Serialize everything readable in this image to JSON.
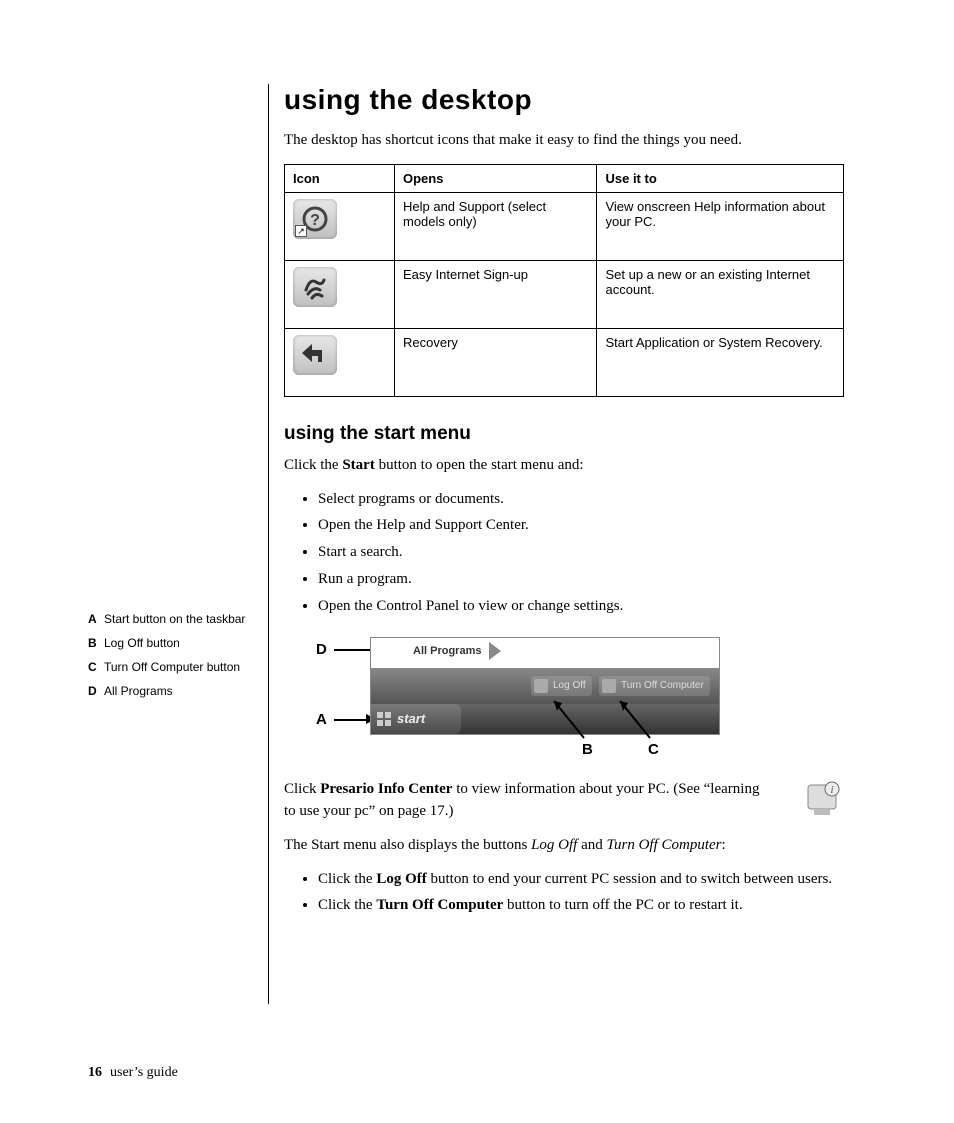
{
  "heading1": "using the desktop",
  "intro": "The desktop has shortcut icons that make it easy to find the things you need.",
  "table": {
    "head": {
      "c1": "Icon",
      "c2": "Opens",
      "c3": "Use it to"
    },
    "rows": [
      {
        "iconName": "help-support-icon",
        "opens": "Help and Support (select models only)",
        "use": "View onscreen Help information about your PC."
      },
      {
        "iconName": "easy-internet-icon",
        "opens": "Easy Internet Sign-up",
        "use": "Set up a new or an existing Internet account."
      },
      {
        "iconName": "recovery-icon",
        "opens": "Recovery",
        "use": "Start Application or System Recovery."
      }
    ]
  },
  "heading2": "using the start menu",
  "startIntro": {
    "pre": "Click the ",
    "bold": "Start",
    "post": " button to open the start menu and:"
  },
  "startBullets": [
    "Select programs or documents.",
    "Open the Help and Support Center.",
    "Start a search.",
    "Run a program.",
    "Open the Control Panel to view or change settings."
  ],
  "legend": [
    {
      "label": "A",
      "text": "Start button on the taskbar"
    },
    {
      "label": "B",
      "text": "Log Off button"
    },
    {
      "label": "C",
      "text": "Turn Off Computer button"
    },
    {
      "label": "D",
      "text": "All Programs"
    }
  ],
  "figure": {
    "callouts": {
      "A": "A",
      "B": "B",
      "C": "C",
      "D": "D"
    },
    "allPrograms": "All Programs",
    "logOff": "Log Off",
    "turnOff": "Turn Off Computer",
    "start": "start"
  },
  "infoPara": {
    "pre": "Click ",
    "bold": "Presario Info Center",
    "post": " to view information about your PC. (See “learning to use your pc” on page 17.)"
  },
  "startMenuAlso": {
    "pre": "The Start menu also displays the buttons ",
    "i1": "Log Off",
    "mid": " and ",
    "i2": "Turn Off Computer",
    "post": ":"
  },
  "endBullets": [
    {
      "pre": "Click the ",
      "bold": "Log Off",
      "post": " button to end your current PC session and to switch between users."
    },
    {
      "pre": "Click the ",
      "bold": "Turn Off Computer",
      "post": " button to turn off the PC or to restart it."
    }
  ],
  "footer": {
    "page": "16",
    "title": "user’s guide"
  }
}
